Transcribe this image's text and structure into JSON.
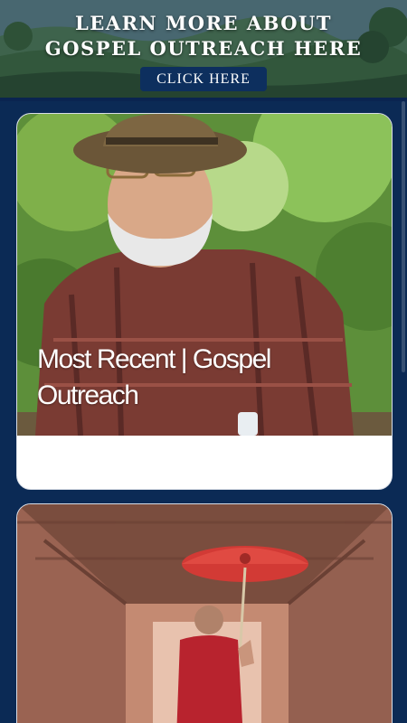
{
  "banner": {
    "title_line1": "LEARN MORE ABOUT",
    "title_line2": "GOSPEL OUTREACH HERE",
    "button_label": "CLICK HERE"
  },
  "cards": [
    {
      "title": "Most Recent | Gospel Outreach",
      "image_subject": "man in brown hat and plaid shirt outdoors"
    },
    {
      "title": "",
      "image_subject": "young monk holding red parasol in wooden corridor"
    }
  ],
  "colors": {
    "page_background": "#0b2a55",
    "banner_button": "#0d2f5e",
    "card_background": "#ffffff"
  }
}
